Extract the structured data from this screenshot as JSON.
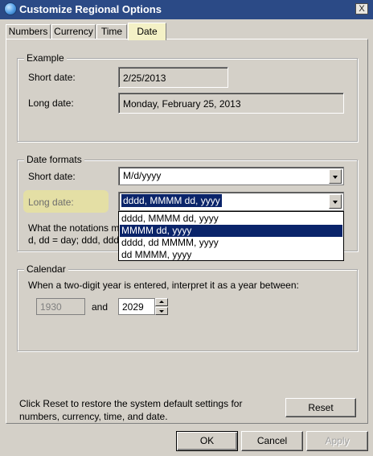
{
  "window": {
    "title": "Customize Regional Options",
    "close_glyph": "X"
  },
  "tabs": [
    {
      "label": "Numbers"
    },
    {
      "label": "Currency"
    },
    {
      "label": "Time"
    },
    {
      "label": "Date"
    }
  ],
  "example": {
    "legend": "Example",
    "short_label": "Short date:",
    "short_value": "2/25/2013",
    "long_label": "Long date:",
    "long_value": "Monday, February 25, 2013"
  },
  "formats": {
    "legend": "Date formats",
    "short_label": "Short date:",
    "short_value": "M/d/yyyy",
    "long_label": "Long date:",
    "long_value": "dddd, MMMM dd, yyyy",
    "notation_line1": "What the notations m",
    "notation_line2": "d, dd = day;  ddd, ddd",
    "dropdown_options": [
      "dddd, MMMM dd, yyyy",
      "MMMM dd, yyyy",
      "dddd, dd MMMM, yyyy",
      "dd MMMM, yyyy"
    ]
  },
  "calendar": {
    "legend": "Calendar",
    "instruction": "When a two-digit year is entered, interpret it as a year between:",
    "from_year": "1930",
    "and_label": "and",
    "to_year": "2029"
  },
  "reset": {
    "text_line1": "Click Reset to restore the system default settings for",
    "text_line2": "numbers, currency, time, and date.",
    "button_label": "Reset"
  },
  "buttons": {
    "ok": "OK",
    "cancel": "Cancel",
    "apply": "Apply"
  }
}
